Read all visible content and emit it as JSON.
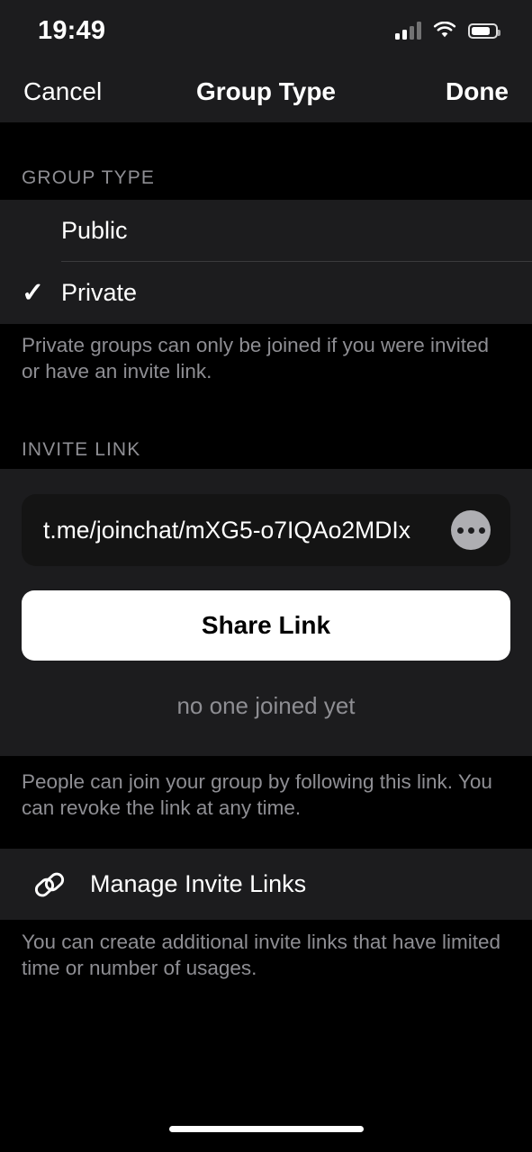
{
  "status_bar": {
    "time": "19:49",
    "cellular_icon": "cellular-signal-icon",
    "cellular_bars_filled": 2,
    "cellular_bars_total": 4,
    "wifi_icon": "wifi-icon",
    "battery_icon": "battery-icon",
    "battery_level_pct": 78
  },
  "nav_bar": {
    "cancel_label": "Cancel",
    "title": "Group Type",
    "done_label": "Done"
  },
  "group_type_section": {
    "header": "GROUP TYPE",
    "options": [
      {
        "label": "Public",
        "selected": false
      },
      {
        "label": "Private",
        "selected": true
      }
    ],
    "checkmark_glyph": "✓",
    "footer": "Private groups can only be joined if you were invited or have an invite link."
  },
  "invite_link_section": {
    "header": "INVITE LINK",
    "link_value": "t.me/joinchat/mXG5-o7IQAo2MDIx",
    "more_button_icon": "ellipsis-icon",
    "share_button_label": "Share Link",
    "joined_status": "no one joined yet",
    "footer": "People can join your group by following this link. You can revoke the link at any time."
  },
  "manage_section": {
    "icon": "link-chain-icon",
    "label": "Manage Invite Links",
    "footer": "You can create additional invite links that have limited time or number of usages."
  },
  "home_indicator": "home-indicator",
  "colors": {
    "background": "#000000",
    "cell_background": "#1c1c1e",
    "field_background": "#141414",
    "secondary_text": "#8e8e93",
    "separator": "#3a3a3c",
    "accent_button": "#ffffff"
  }
}
